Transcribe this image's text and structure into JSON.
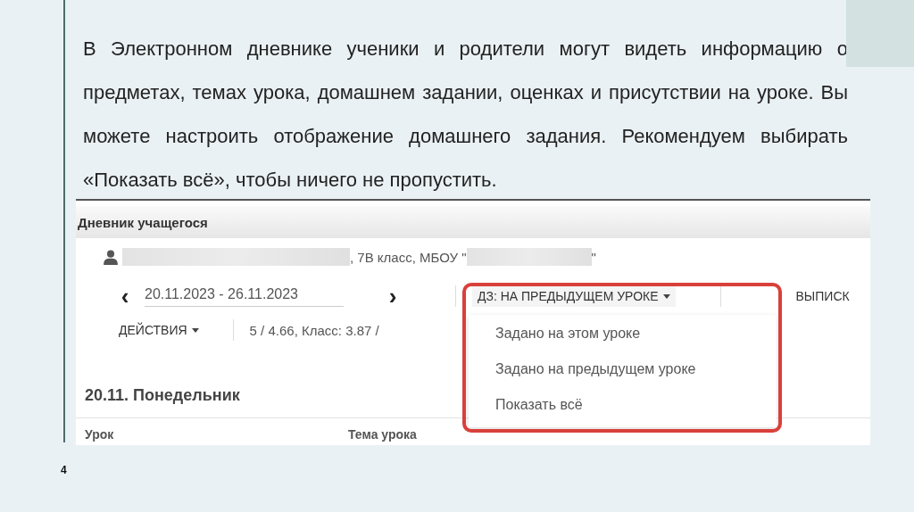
{
  "slide": {
    "paragraph": "В Электронном дневнике ученики и родители могут видеть информацию о предметах, темах урока, домашнем задании, оценках и присутствии на уроке. Вы можете настроить отображение домашнего задания. Рекомендуем выбирать «Показать всё», чтобы ничего не пропустить.",
    "page_number": "4"
  },
  "screenshot": {
    "header": "Дневник учащегося",
    "student": {
      "info": ", 7В класс, МБОУ \"",
      "closing": "\""
    },
    "week": {
      "prev": "‹",
      "range": "20.11.2023 - 26.11.2023",
      "next": "›"
    },
    "homework_dropdown": {
      "label": "ДЗ: НА ПРЕДЫДУЩЕМ УРОКЕ",
      "expanded": true,
      "options": [
        "Задано на этом уроке",
        "Задано на предыдущем уроке",
        "Показать всё"
      ]
    },
    "statement_button": "ВЫПИСК",
    "actions_button": "ДЕЙСТВИЯ",
    "averages": "5 / 4.66, Класс: 3.87 /",
    "day_heading": "20.11. Понедельник",
    "table": {
      "columns": [
        "Урок",
        "Тема урока"
      ]
    }
  }
}
